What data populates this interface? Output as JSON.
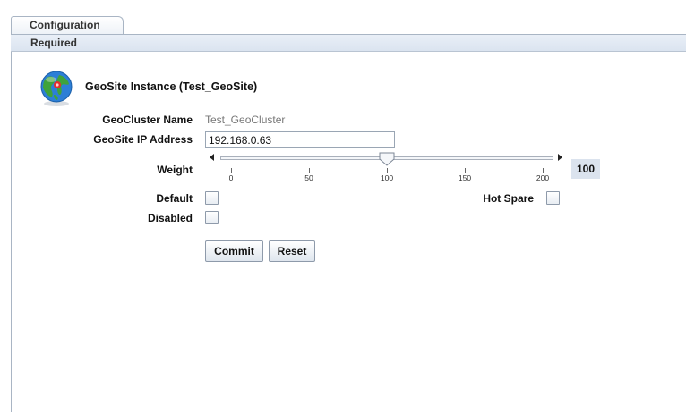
{
  "tabs": {
    "configuration_label": "Configuration"
  },
  "subtab": {
    "required_label": "Required"
  },
  "instance": {
    "title": "GeoSite Instance (Test_GeoSite)"
  },
  "fields": {
    "geocluster_name_label": "GeoCluster Name",
    "geocluster_name_value": "Test_GeoCluster",
    "geosite_ip_label": "GeoSite IP Address",
    "geosite_ip_value": "192.168.0.63",
    "weight_label": "Weight",
    "default_label": "Default",
    "disabled_label": "Disabled",
    "hot_spare_label": "Hot Spare"
  },
  "weight_slider": {
    "min": 0,
    "max": 200,
    "value": 100,
    "value_display": "100",
    "tick_labels": [
      "0",
      "50",
      "100",
      "150",
      "200"
    ]
  },
  "checkboxes": {
    "default": false,
    "disabled": false,
    "hot_spare": false
  },
  "buttons": {
    "commit_label": "Commit",
    "reset_label": "Reset"
  },
  "icons": {
    "instance_icon": "globe-icon"
  }
}
